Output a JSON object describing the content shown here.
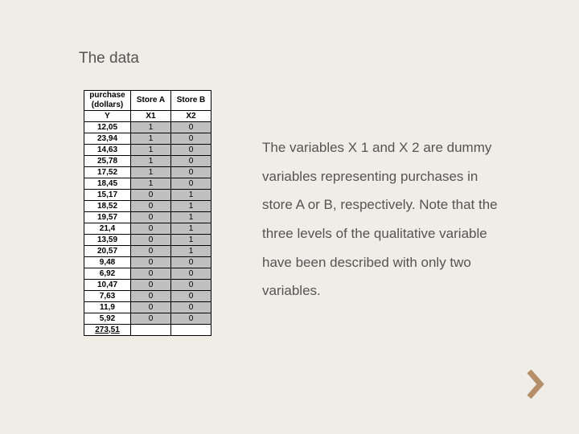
{
  "title": "The data",
  "paragraph": "The variables X 1 and X 2 are dummy variables representing purchases in store A or B, respectively. Note that the three levels of the qualitative variable have been described with only two variables.",
  "table": {
    "header1": {
      "purchase_line1": "purchase",
      "purchase_line2": "(dollars)",
      "storeA": "Store A",
      "storeB": "Store B"
    },
    "header2": {
      "y": "Y",
      "x1": "X1",
      "x2": "X2"
    },
    "rows": [
      {
        "y": "12,05",
        "x1": "1",
        "x2": "0"
      },
      {
        "y": "23,94",
        "x1": "1",
        "x2": "0"
      },
      {
        "y": "14,63",
        "x1": "1",
        "x2": "0"
      },
      {
        "y": "25,78",
        "x1": "1",
        "x2": "0"
      },
      {
        "y": "17,52",
        "x1": "1",
        "x2": "0"
      },
      {
        "y": "18,45",
        "x1": "1",
        "x2": "0"
      },
      {
        "y": "15,17",
        "x1": "0",
        "x2": "1"
      },
      {
        "y": "18,52",
        "x1": "0",
        "x2": "1"
      },
      {
        "y": "19,57",
        "x1": "0",
        "x2": "1"
      },
      {
        "y": "21,4",
        "x1": "0",
        "x2": "1"
      },
      {
        "y": "13,59",
        "x1": "0",
        "x2": "1"
      },
      {
        "y": "20,57",
        "x1": "0",
        "x2": "1"
      },
      {
        "y": "9,48",
        "x1": "0",
        "x2": "0"
      },
      {
        "y": "6,92",
        "x1": "0",
        "x2": "0"
      },
      {
        "y": "10,47",
        "x1": "0",
        "x2": "0"
      },
      {
        "y": "7,63",
        "x1": "0",
        "x2": "0"
      },
      {
        "y": "11,9",
        "x1": "0",
        "x2": "0"
      },
      {
        "y": "5,92",
        "x1": "0",
        "x2": "0"
      }
    ],
    "total": "273,51"
  },
  "chart_data": {
    "type": "table",
    "title": "The data",
    "columns": [
      "purchase (dollars) Y",
      "Store A X1",
      "Store B X2"
    ],
    "rows": [
      [
        12.05,
        1,
        0
      ],
      [
        23.94,
        1,
        0
      ],
      [
        14.63,
        1,
        0
      ],
      [
        25.78,
        1,
        0
      ],
      [
        17.52,
        1,
        0
      ],
      [
        18.45,
        1,
        0
      ],
      [
        15.17,
        0,
        1
      ],
      [
        18.52,
        0,
        1
      ],
      [
        19.57,
        0,
        1
      ],
      [
        21.4,
        0,
        1
      ],
      [
        13.59,
        0,
        1
      ],
      [
        20.57,
        0,
        1
      ],
      [
        9.48,
        0,
        0
      ],
      [
        6.92,
        0,
        0
      ],
      [
        10.47,
        0,
        0
      ],
      [
        7.63,
        0,
        0
      ],
      [
        11.9,
        0,
        0
      ],
      [
        5.92,
        0,
        0
      ]
    ],
    "total_y": 273.51
  }
}
